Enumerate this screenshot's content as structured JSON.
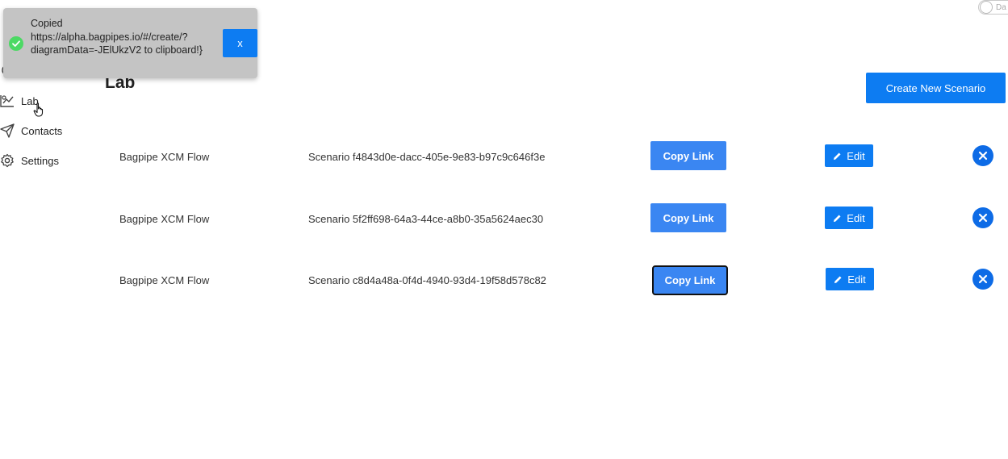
{
  "mode_toggle": {
    "label": "Da"
  },
  "sidebar": {
    "items": [
      {
        "label": "Lab",
        "icon": "lab-icon"
      },
      {
        "label": "Contacts",
        "icon": "send-icon"
      },
      {
        "label": "Settings",
        "icon": "gear-icon"
      }
    ]
  },
  "main": {
    "title": "Lab",
    "create_button": "Create New Scenario",
    "rows": [
      {
        "flow": "Bagpipe XCM Flow",
        "scenario": "Scenario f4843d0e-dacc-405e-9e83-b97c9c646f3e",
        "copy_label": "Copy Link",
        "edit_label": "Edit"
      },
      {
        "flow": "Bagpipe XCM Flow",
        "scenario": "Scenario 5f2ff698-64a3-44ce-a8b0-35a5624aec30",
        "copy_label": "Copy Link",
        "edit_label": "Edit"
      },
      {
        "flow": "Bagpipe XCM Flow",
        "scenario": "Scenario c8d4a48a-0f4d-4940-93d4-19f58d578c82",
        "copy_label": "Copy Link",
        "edit_label": "Edit"
      }
    ]
  },
  "toast": {
    "message": "Copied https://alpha.bagpipes.io/#/create/?diagramData=-JElUkzV2 to clipboard!}",
    "close_label": "x"
  },
  "colors": {
    "primary": "#0d7cf2",
    "copy_button": "#3a86f2",
    "toast_bg": "#c4c4c4",
    "success": "#4cd964"
  }
}
